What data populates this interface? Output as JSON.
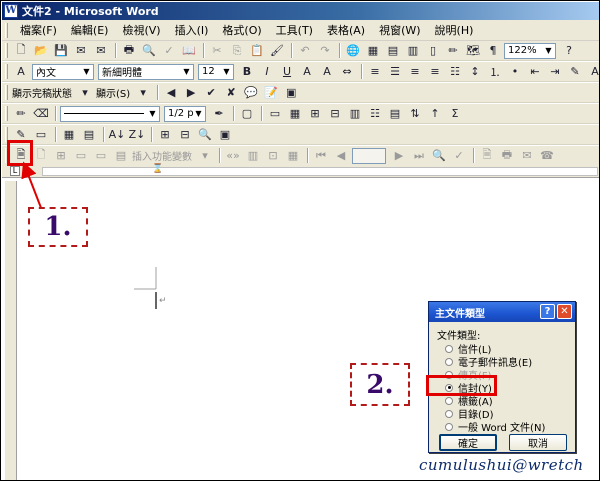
{
  "window": {
    "title": "文件2 - Microsoft Word"
  },
  "menubar": {
    "items": [
      "檔案(F)",
      "編輯(E)",
      "檢視(V)",
      "插入(I)",
      "格式(O)",
      "工具(T)",
      "表格(A)",
      "視窗(W)",
      "說明(H)"
    ]
  },
  "standard_toolbar": {
    "zoom": "122%"
  },
  "formatting_toolbar": {
    "style": "內文",
    "font": "新細明體",
    "size": "12"
  },
  "reviewing_toolbar": {
    "display_mode": "顯示完稿狀態",
    "show_label": "顯示(S)"
  },
  "drawing_toolbar": {
    "line_weight": "1/2 p"
  },
  "mailmerge_toolbar": {
    "insert_field_label": "插入功能變數"
  },
  "annotations": {
    "step1": "1.",
    "step2": "2."
  },
  "dialog": {
    "title": "主文件類型",
    "group_label": "文件類型:",
    "options": [
      {
        "label": "信件(L)",
        "enabled": true
      },
      {
        "label": "電子郵件訊息(E)",
        "enabled": true
      },
      {
        "label": "傳真(F)",
        "enabled": false
      },
      {
        "label": "信封(Y)",
        "enabled": true,
        "selected": true
      },
      {
        "label": "標籤(A)",
        "enabled": true
      },
      {
        "label": "目錄(D)",
        "enabled": true
      },
      {
        "label": "一般 Word 文件(N)",
        "enabled": true
      }
    ],
    "ok_label": "確定",
    "cancel_label": "取消",
    "help_label": "?",
    "close_label": "✕"
  },
  "signature": "cumulushui@wretch",
  "colors": {
    "highlight_red": "#e00000",
    "dash_border": "#b31b1b",
    "annotation_text": "#3a0a6a",
    "title_bar": "#0a246a"
  }
}
